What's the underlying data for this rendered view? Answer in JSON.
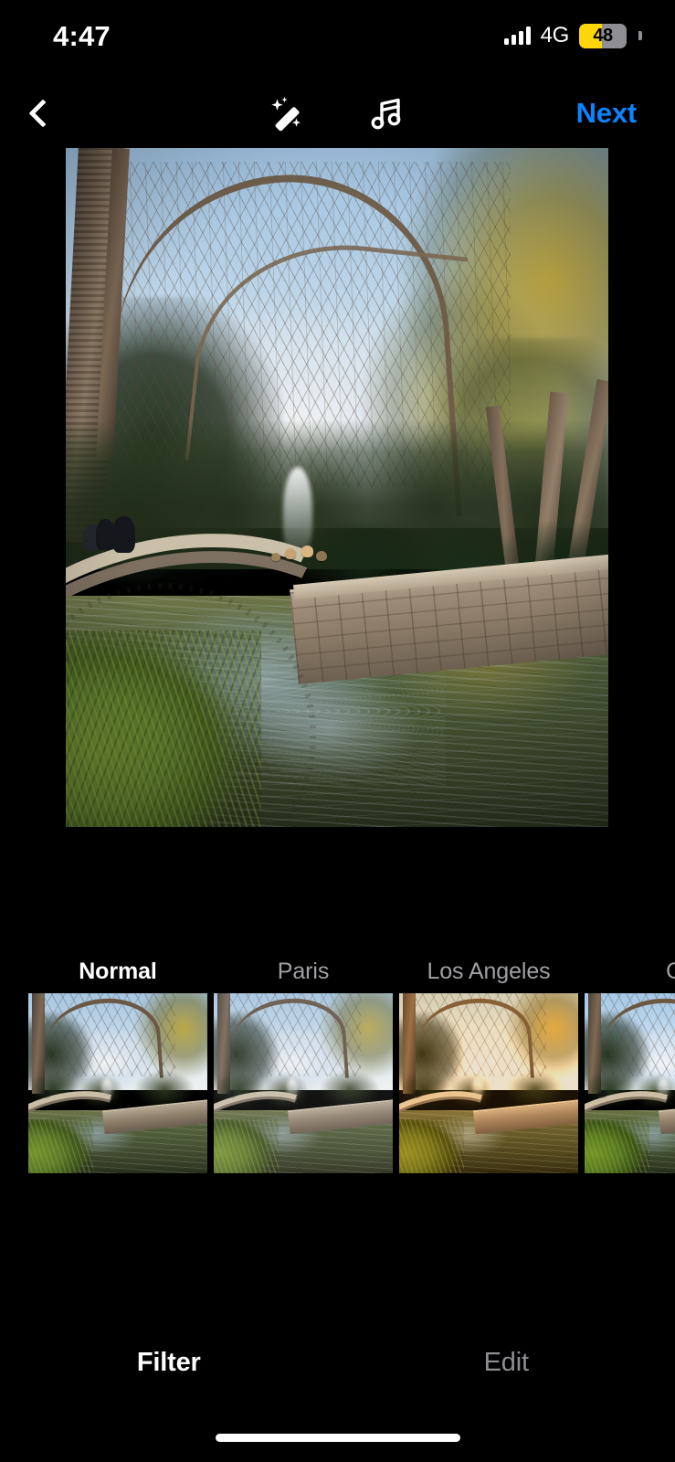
{
  "status_bar": {
    "time": "4:47",
    "network": "4G",
    "battery_level": "48",
    "battery_percent": 48,
    "battery_low_power_color": "#ffd60a",
    "signal_icon": "cellular-signal-icon",
    "battery_icon": "battery-icon"
  },
  "nav_bar": {
    "back_icon": "chevron-left-icon",
    "magic_icon": "magic-wand-icon",
    "music_icon": "music-note-icon",
    "next_label": "Next",
    "next_color": "#0a84ff"
  },
  "photo": {
    "alt": "Park pond with curved stone walkway, ducks, fountain and autumn trees",
    "selected_filter": "Normal"
  },
  "filters": {
    "items": [
      {
        "label": "Normal",
        "selected": true,
        "class": "f-normal"
      },
      {
        "label": "Paris",
        "selected": false,
        "class": "f-paris"
      },
      {
        "label": "Los Angeles",
        "selected": false,
        "class": "f-losangeles"
      },
      {
        "label": "C",
        "selected": false,
        "class": "f-c"
      }
    ]
  },
  "tabs": {
    "items": [
      {
        "label": "Filter",
        "active": true
      },
      {
        "label": "Edit",
        "active": false
      }
    ]
  },
  "home_indicator": "home-indicator"
}
